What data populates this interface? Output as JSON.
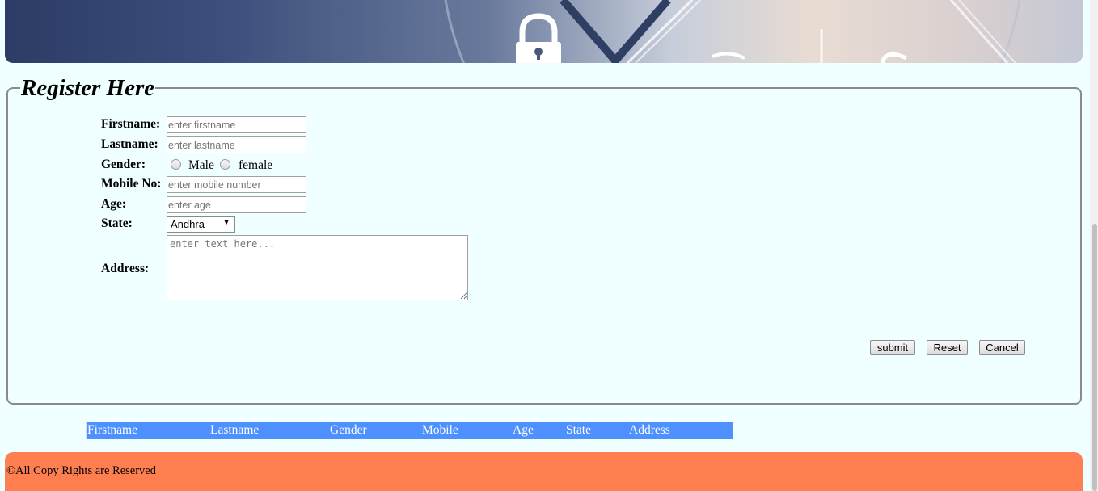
{
  "form": {
    "legend": "Register Here",
    "fields": {
      "firstname": {
        "label": "Firstname:",
        "placeholder": "enter firstname"
      },
      "lastname": {
        "label": "Lastname:",
        "placeholder": "enter lastname"
      },
      "gender": {
        "label": "Gender:",
        "options": [
          "Male",
          "female"
        ]
      },
      "mobile": {
        "label": "Mobile No:",
        "placeholder": "enter mobile number"
      },
      "age": {
        "label": "Age:",
        "placeholder": "enter age"
      },
      "state": {
        "label": "State:",
        "selected": "Andhra"
      },
      "address": {
        "label": "Address:",
        "placeholder": "enter text here..."
      }
    },
    "buttons": {
      "submit": "submit",
      "reset": "Reset",
      "cancel": "Cancel"
    }
  },
  "table": {
    "headers": [
      "Firstname",
      "Lastname",
      "Gender",
      "Mobile",
      "Age",
      "State",
      "Address"
    ]
  },
  "footer": {
    "text": "©All Copy Rights are Reserved"
  },
  "colors": {
    "page_bg": "#f0ffff",
    "table_header_bg": "#4d90fe",
    "footer_bg": "#ff7f50"
  },
  "icons": {
    "banner": "lock-icon"
  }
}
